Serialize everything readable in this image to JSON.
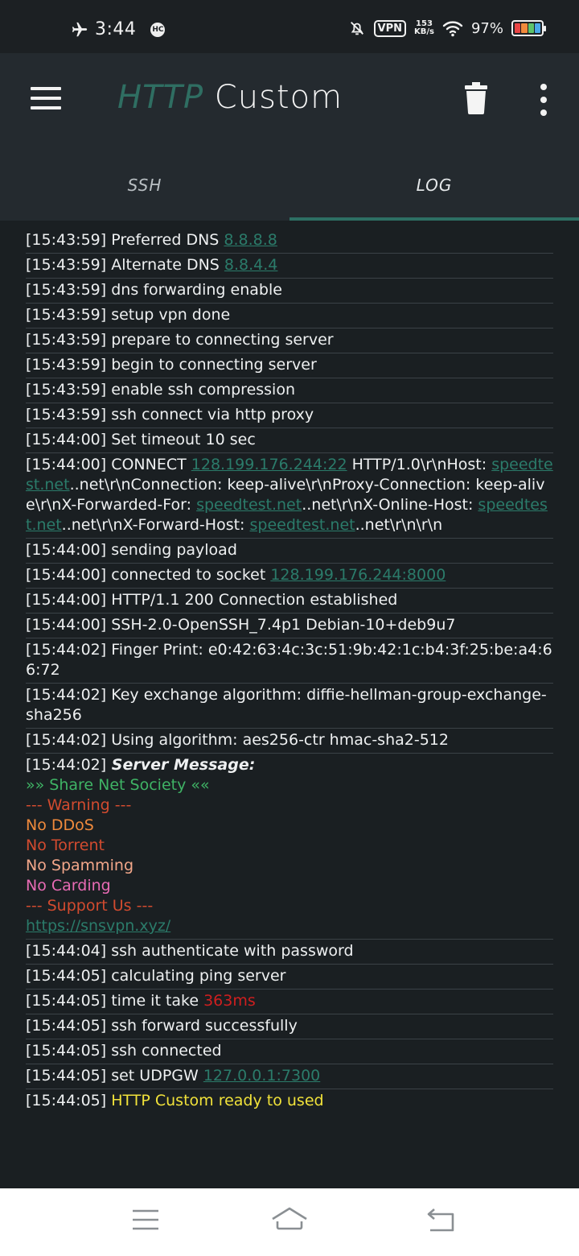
{
  "status_bar": {
    "time": "3:44",
    "notif_badge": "HC",
    "vpn_label": "VPN",
    "speed_value": "153",
    "speed_unit": "KB/s",
    "battery_pct": "97%",
    "battery_level": 0.97,
    "battery_colors": [
      "#e84545",
      "#f08a3c",
      "#5ec46b",
      "#4aa8e8"
    ]
  },
  "app_bar": {
    "title_part1": "HTTP",
    "title_part2": "Custom",
    "title_part1_color": "#2f6e62",
    "accent_color": "#2d6f63"
  },
  "tabs": [
    {
      "label": "SSH",
      "active": false
    },
    {
      "label": "LOG",
      "active": true
    }
  ],
  "log": {
    "entries": [
      {
        "ts": "[15:43:59]",
        "parts": [
          {
            "t": " Preferred DNS "
          },
          {
            "t": "8.8.8.8",
            "c": "lnk"
          }
        ]
      },
      {
        "ts": "[15:43:59]",
        "parts": [
          {
            "t": " Alternate DNS "
          },
          {
            "t": "8.8.4.4",
            "c": "lnk"
          }
        ]
      },
      {
        "ts": "[15:43:59]",
        "parts": [
          {
            "t": " dns forwarding enable"
          }
        ]
      },
      {
        "ts": "[15:43:59]",
        "parts": [
          {
            "t": " setup vpn done"
          }
        ]
      },
      {
        "ts": "[15:43:59]",
        "parts": [
          {
            "t": " prepare to connecting server"
          }
        ]
      },
      {
        "ts": "[15:43:59]",
        "parts": [
          {
            "t": " begin to connecting server"
          }
        ]
      },
      {
        "ts": "[15:43:59]",
        "parts": [
          {
            "t": " enable ssh compression"
          }
        ]
      },
      {
        "ts": "[15:43:59]",
        "parts": [
          {
            "t": " ssh connect via http proxy"
          }
        ]
      },
      {
        "ts": "[15:44:00]",
        "parts": [
          {
            "t": " Set timeout 10 sec"
          }
        ]
      },
      {
        "ts": "[15:44:00]",
        "parts": [
          {
            "t": " CONNECT "
          },
          {
            "t": "128.199.176.244:22",
            "c": "lnk"
          },
          {
            "t": " HTTP/1.0\\r\\nHost: "
          },
          {
            "t": "speedtest.net",
            "c": "lnk"
          },
          {
            "t": "..net\\r\\nConnection: keep-alive\\r\\nProxy-Connection: keep-alive\\r\\nX-Forwarded-For: "
          },
          {
            "t": "speedtest.net",
            "c": "lnk"
          },
          {
            "t": "..net\\r\\nX-Online-Host: "
          },
          {
            "t": "speedtest.net",
            "c": "lnk"
          },
          {
            "t": "..net\\r\\nX-Forward-Host: "
          },
          {
            "t": "speedtest.net",
            "c": "lnk"
          },
          {
            "t": "..net\\r\\n\\r\\n"
          }
        ]
      },
      {
        "ts": "[15:44:00]",
        "parts": [
          {
            "t": " sending payload"
          }
        ]
      },
      {
        "ts": "[15:44:00]",
        "parts": [
          {
            "t": " connected to socket "
          },
          {
            "t": "128.199.176.244:8000",
            "c": "lnk"
          }
        ]
      },
      {
        "ts": "[15:44:00]",
        "parts": [
          {
            "t": " HTTP/1.1 200 Connection established"
          }
        ]
      },
      {
        "ts": "[15:44:00]",
        "parts": [
          {
            "t": " SSH-2.0-OpenSSH_7.4p1 Debian-10+deb9u7"
          }
        ]
      },
      {
        "ts": "[15:44:02]",
        "parts": [
          {
            "t": " Finger Print: e0:42:63:4c:3c:51:9b:42:1c:b4:3f:25:be:a4:66:72"
          }
        ]
      },
      {
        "ts": "[15:44:02]",
        "parts": [
          {
            "t": " Key exchange algorithm: diffie-hellman-group-exchange-sha256"
          }
        ]
      },
      {
        "ts": "[15:44:02]",
        "parts": [
          {
            "t": " Using algorithm: aes256-ctr hmac-sha2-512"
          }
        ]
      },
      {
        "ts": "[15:44:02]",
        "parts": [
          {
            "t": " Server Message:",
            "c": "bold"
          },
          {
            "t": "»» Share Net Society ««",
            "c": "c-green",
            "line": true
          },
          {
            "t": "--- Warning ---",
            "c": "c-red",
            "line": true
          },
          {
            "t": "No DDoS",
            "c": "c-orange",
            "line": true
          },
          {
            "t": "No Torrent",
            "c": "c-red",
            "line": true
          },
          {
            "t": "No Spamming",
            "c": "c-peach",
            "line": true
          },
          {
            "t": "No Carding",
            "c": "c-pink",
            "line": true
          },
          {
            "t": "--- Support Us ---",
            "c": "c-red",
            "line": true
          },
          {
            "t": "https://snsvpn.xyz/",
            "c": "lnk",
            "line": true
          }
        ]
      },
      {
        "ts": "[15:44:04]",
        "parts": [
          {
            "t": " ssh authenticate with password"
          }
        ]
      },
      {
        "ts": "[15:44:05]",
        "parts": [
          {
            "t": " calculating ping server"
          }
        ]
      },
      {
        "ts": "[15:44:05]",
        "parts": [
          {
            "t": " time it take "
          },
          {
            "t": "363ms",
            "c": "c-ms"
          }
        ]
      },
      {
        "ts": "[15:44:05]",
        "parts": [
          {
            "t": " ssh forward successfully"
          }
        ]
      },
      {
        "ts": "[15:44:05]",
        "parts": [
          {
            "t": " ssh connected"
          }
        ]
      },
      {
        "ts": "[15:44:05]",
        "parts": [
          {
            "t": " set UDPGW "
          },
          {
            "t": "127.0.0.1:7300",
            "c": "lnk"
          }
        ]
      },
      {
        "ts": "[15:44:05]",
        "parts": [
          {
            "t": " HTTP Custom ready to used",
            "c": "c-yellow"
          }
        ]
      }
    ]
  },
  "nav_bar": {
    "buttons": [
      "menu-icon",
      "home-icon",
      "back-icon"
    ]
  }
}
